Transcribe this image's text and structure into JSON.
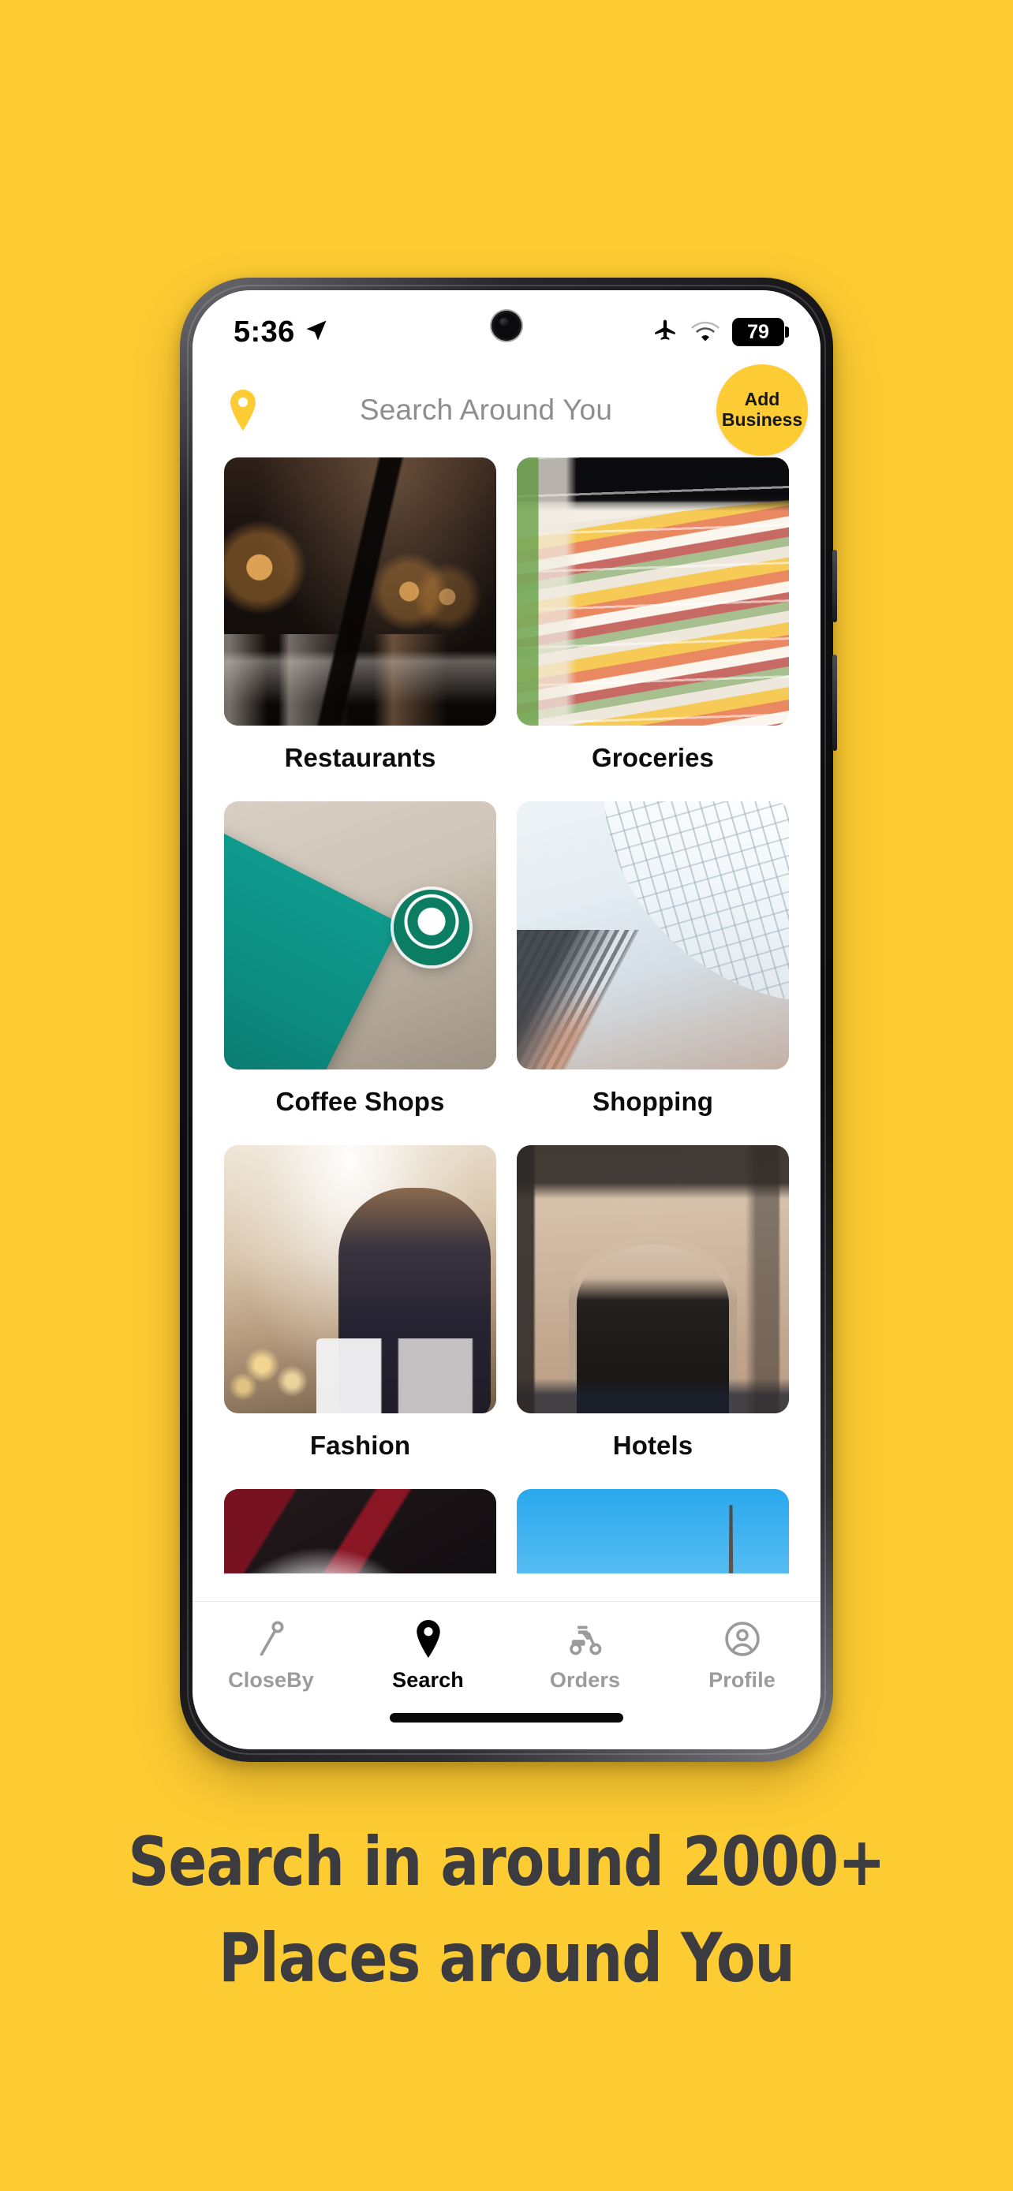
{
  "theme": {
    "brand_yellow": "#FDCC33",
    "accent_yellow": "#FDCB34",
    "text_dark": "#3b3b40",
    "muted_gray": "#9b9b9b"
  },
  "status_bar": {
    "time": "5:36",
    "location_icon": "navigation-arrow-icon",
    "airplane_icon": "airplane-mode-icon",
    "wifi_icon": "wifi-icon",
    "battery_level": "79"
  },
  "header": {
    "pin_icon": "location-pin-icon",
    "title": "Search Around You",
    "add_business_line1": "Add",
    "add_business_line2": "Business"
  },
  "categories": [
    {
      "label": "Restaurants",
      "image": "restaurant-interior-photo",
      "style": "ph-restaurant"
    },
    {
      "label": "Groceries",
      "image": "grocery-aisle-photo",
      "style": "ph-groceries"
    },
    {
      "label": "Coffee Shops",
      "image": "starbucks-storefront-photo",
      "style": "ph-coffee"
    },
    {
      "label": "Shopping",
      "image": "shopping-mall-photo",
      "style": "ph-shopping"
    },
    {
      "label": "Fashion",
      "image": "fashion-shopper-photo",
      "style": "ph-fashion"
    },
    {
      "label": "Hotels",
      "image": "montecarlo-hotel-photo",
      "style": "ph-hotel"
    }
  ],
  "partial_row": [
    {
      "label": "",
      "image": "salon-beauty-photo",
      "style": "ph-salon"
    },
    {
      "label": "",
      "image": "eiffel-tower-photo",
      "style": "ph-travel"
    }
  ],
  "bottom_nav": [
    {
      "label": "CloseBy",
      "icon": "map-needle-icon",
      "active": false
    },
    {
      "label": "Search",
      "icon": "location-pin-icon",
      "active": true
    },
    {
      "label": "Orders",
      "icon": "delivery-scooter-icon",
      "active": false
    },
    {
      "label": "Profile",
      "icon": "user-circle-icon",
      "active": false
    }
  ],
  "caption": {
    "line1": "Search in around 2000+",
    "line2": "Places around You"
  }
}
